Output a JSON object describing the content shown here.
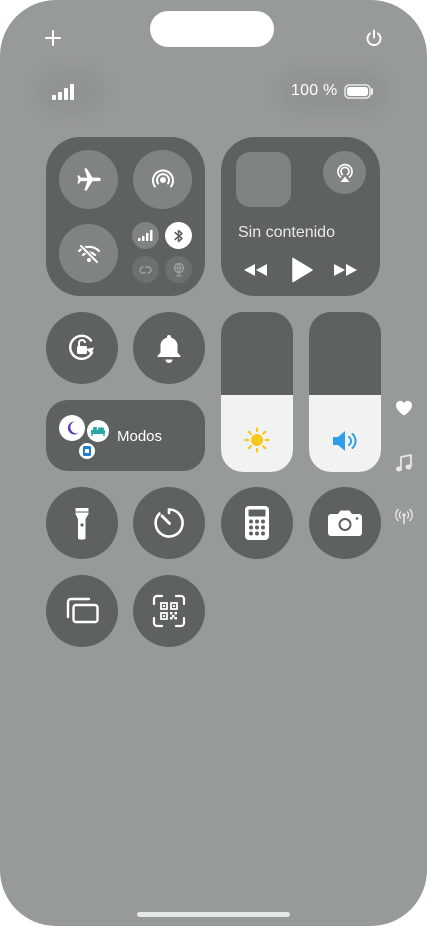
{
  "status": {
    "battery_text": "100 %",
    "battery_level": 1.0
  },
  "media": {
    "title": "Sin contenido"
  },
  "focus": {
    "label": "Modos"
  },
  "sliders": {
    "brightness_level": 0.48,
    "volume_level": 0.48
  },
  "colors": {
    "background": "#969a99",
    "module": "#5d6261",
    "sub_circle": "#7f8483",
    "sun": "#f7c719",
    "speaker": "#2f9ee8",
    "moon_purple": "#5e3db9",
    "bed_teal": "#26a7a2",
    "work_blue": "#1f7ecd"
  },
  "icons": [
    "plus-icon",
    "power-icon",
    "cellular-signal-icon",
    "battery-icon",
    "airplane-icon",
    "airdrop-icon",
    "wifi-off-icon",
    "cellular-data-icon",
    "bluetooth-icon",
    "personal-hotspot-icon",
    "vpn-icon",
    "airplay-icon",
    "rewind-icon",
    "play-icon",
    "fast-forward-icon",
    "rotation-lock-icon",
    "bell-icon",
    "moon-icon",
    "bed-icon",
    "badge-icon",
    "sun-icon",
    "speaker-icon",
    "heart-icon",
    "music-note-icon",
    "wireless-icon",
    "flashlight-icon",
    "timer-icon",
    "calculator-icon",
    "camera-icon",
    "screen-mirroring-icon",
    "qr-code-icon"
  ]
}
